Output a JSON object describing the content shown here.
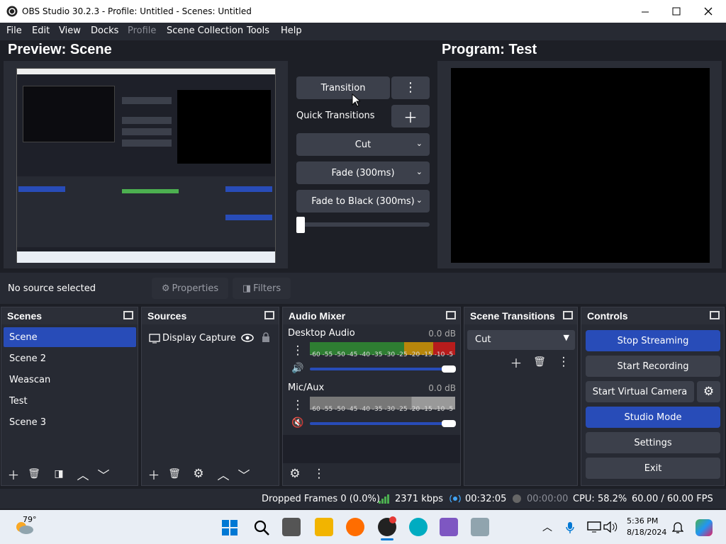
{
  "window": {
    "title": "OBS Studio 30.2.3 - Profile: Untitled - Scenes: Untitled"
  },
  "menu": [
    "File",
    "Edit",
    "View",
    "Docks",
    "Profile",
    "Scene Collection",
    "Tools",
    "Help"
  ],
  "preview": {
    "title": "Preview: Scene"
  },
  "program": {
    "title": "Program: Test"
  },
  "transition_panel": {
    "transition_button": "Transition",
    "quick_transitions": "Quick Transitions",
    "cut": "Cut",
    "fade": "Fade (300ms)",
    "fade_black": "Fade to Black (300ms)"
  },
  "context_bar": {
    "no_source": "No source selected",
    "properties": "Properties",
    "filters": "Filters"
  },
  "scenes": {
    "title": "Scenes",
    "items": [
      "Scene",
      "Scene 2",
      "Weascan",
      "Test",
      "Scene 3"
    ]
  },
  "sources": {
    "title": "Sources",
    "items": [
      "Display Capture"
    ]
  },
  "audio_mixer": {
    "title": "Audio Mixer",
    "channels": [
      {
        "name": "Desktop Audio",
        "db": "0.0 dB"
      },
      {
        "name": "Mic/Aux",
        "db": "0.0 dB"
      }
    ],
    "scale": "-60 -55 -50 -45 -40 -35 -30 -25 -20 -15 -10  -5  0"
  },
  "scene_transitions": {
    "title": "Scene Transitions",
    "selected": "Cut"
  },
  "controls": {
    "title": "Controls",
    "stop_streaming": "Stop Streaming",
    "start_recording": "Start Recording",
    "start_virtual_camera": "Start Virtual Camera",
    "studio_mode": "Studio Mode",
    "settings": "Settings",
    "exit": "Exit"
  },
  "status": {
    "dropped_frames": "Dropped Frames 0 (0.0%)",
    "bitrate": "2371 kbps",
    "stream_time": "00:32:05",
    "rec_time": "00:00:00",
    "cpu": "CPU: 58.2%",
    "fps": "60.00 / 60.00 FPS"
  },
  "taskbar": {
    "temp": "79°",
    "time": "5:36 PM",
    "date": "8/18/2024"
  },
  "colors": {
    "accent": "#284cb8",
    "panel": "#272a33",
    "background": "#1d1f26"
  }
}
